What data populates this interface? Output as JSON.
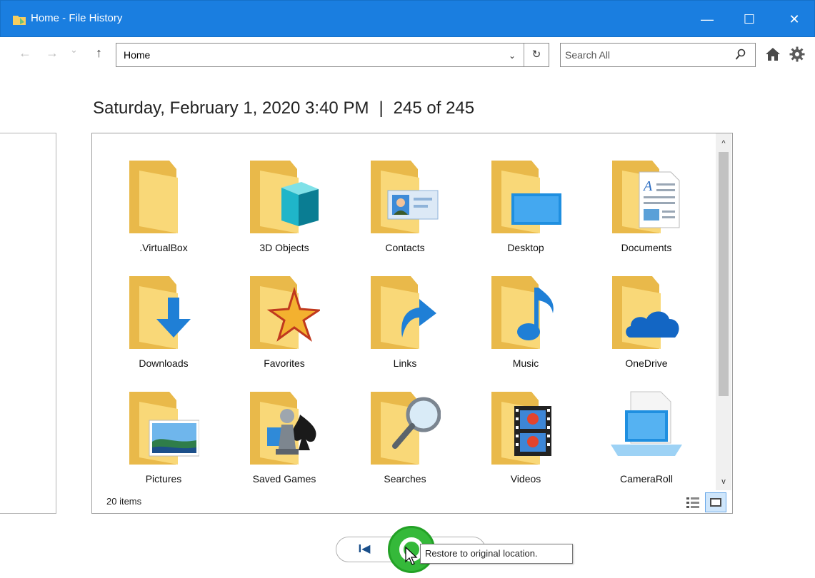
{
  "window": {
    "title": "Home - File History",
    "minimize_glyph": "—",
    "maximize_glyph": "☐",
    "close_glyph": "✕"
  },
  "nav": {
    "back_glyph": "←",
    "forward_glyph": "→",
    "recent_glyph": "⌄",
    "up_glyph": "↑",
    "address": "Home",
    "address_dropdown_glyph": "⌄",
    "refresh_glyph": "↻",
    "search_placeholder": "Search All",
    "search_icon": "search-icon",
    "home_icon": "home-icon",
    "settings_icon": "gear-icon"
  },
  "snapshot": {
    "date": "Saturday, February 1, 2020 3:40 PM",
    "separator": "|",
    "position": "245 of 245"
  },
  "files": {
    "items": [
      {
        "label": ".VirtualBox",
        "icon": "folder-icon"
      },
      {
        "label": "3D Objects",
        "icon": "3d-objects-folder-icon"
      },
      {
        "label": "Contacts",
        "icon": "contacts-folder-icon"
      },
      {
        "label": "Desktop",
        "icon": "desktop-folder-icon"
      },
      {
        "label": "Documents",
        "icon": "documents-folder-icon"
      },
      {
        "label": "Downloads",
        "icon": "downloads-folder-icon"
      },
      {
        "label": "Favorites",
        "icon": "favorites-folder-icon"
      },
      {
        "label": "Links",
        "icon": "links-folder-icon"
      },
      {
        "label": "Music",
        "icon": "music-folder-icon"
      },
      {
        "label": "OneDrive",
        "icon": "onedrive-folder-icon"
      },
      {
        "label": "Pictures",
        "icon": "pictures-folder-icon"
      },
      {
        "label": "Saved Games",
        "icon": "saved-games-folder-icon"
      },
      {
        "label": "Searches",
        "icon": "searches-folder-icon"
      },
      {
        "label": "Videos",
        "icon": "videos-folder-icon"
      },
      {
        "label": "CameraRoll",
        "icon": "camera-roll-icon"
      }
    ],
    "status": "20 items",
    "scroll_up_glyph": "^",
    "scroll_down_glyph": "v"
  },
  "controls": {
    "previous_glyph": "I◀",
    "next_glyph": "▶I",
    "restore_tooltip": "Restore to original location."
  },
  "colors": {
    "titlebar": "#1a7ee0",
    "folder": "#f6cd5f",
    "restore_green": "#35b93a"
  }
}
